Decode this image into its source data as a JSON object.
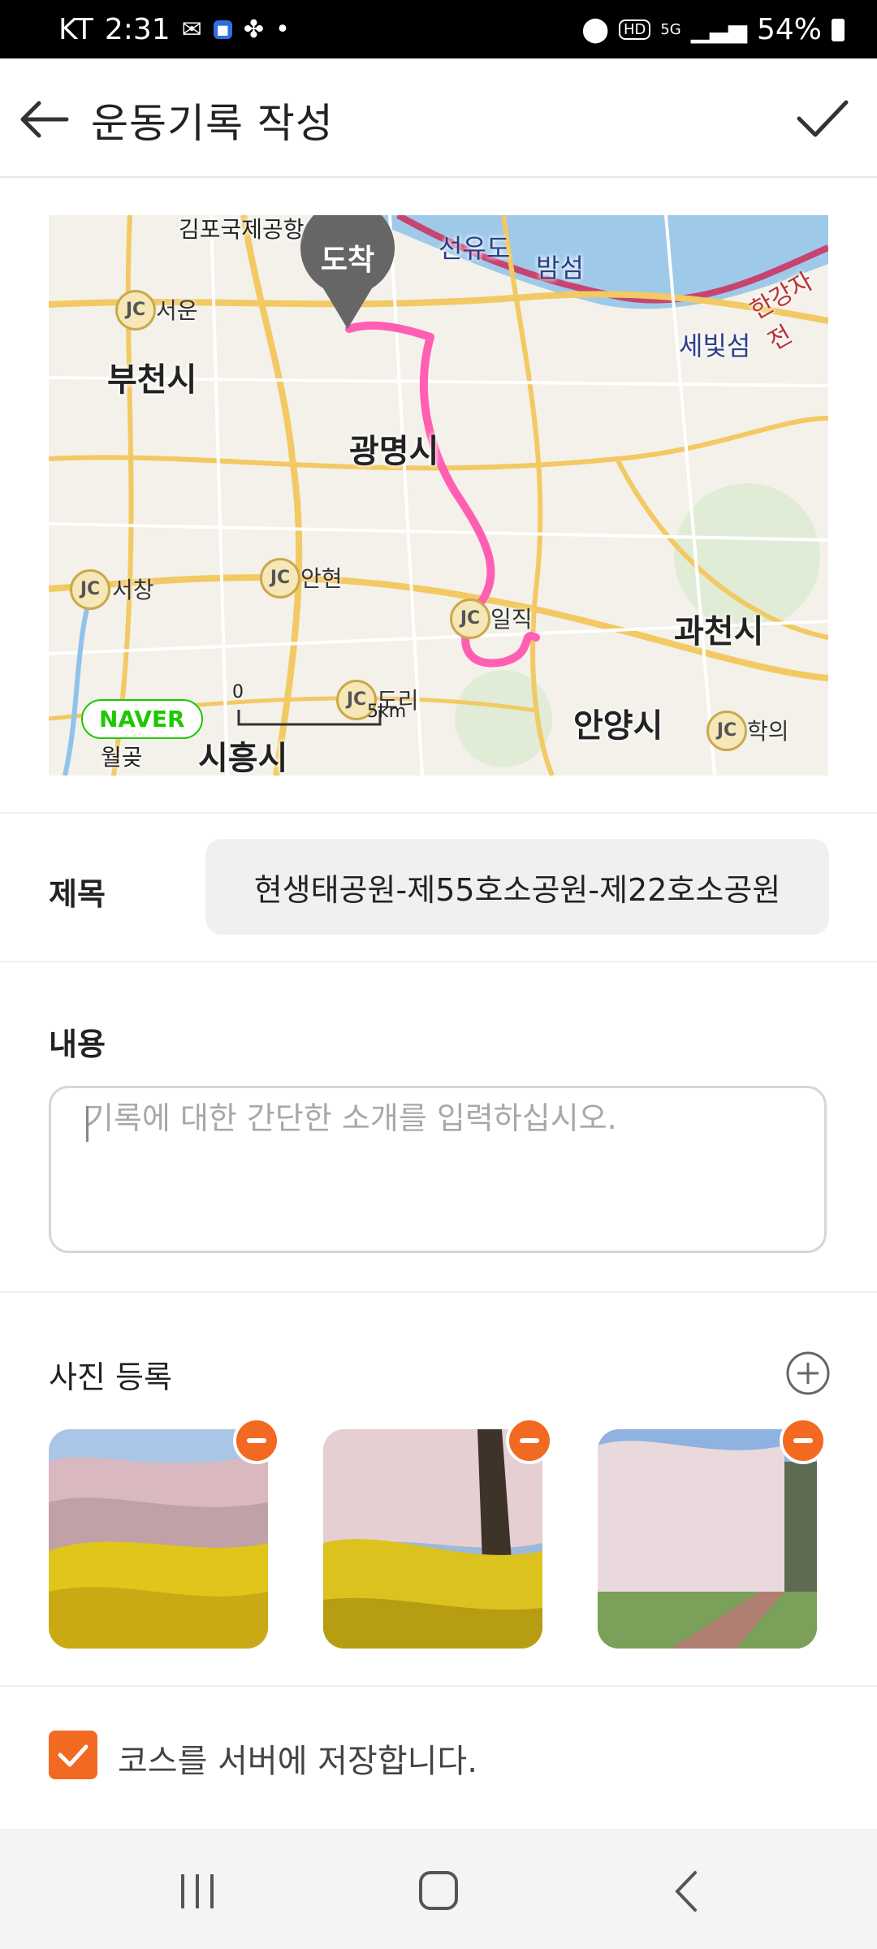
{
  "status_bar": {
    "carrier": "KT",
    "time": "2:31",
    "battery": "54%",
    "network": "5G",
    "hd": "HD"
  },
  "app_bar": {
    "title": "운동기록 작성"
  },
  "map": {
    "arrival_label": "도착",
    "brand": "NAVER",
    "scale_start": "0",
    "scale_end": "5km",
    "cities": [
      "부천시",
      "광명시",
      "과천시",
      "안양시",
      "시흥시"
    ],
    "places": [
      "선유도",
      "밤섬",
      "세빛섬",
      "한강자전",
      "월곶",
      "김포국제공항"
    ],
    "junctions": [
      "서운",
      "안현",
      "서창",
      "일직",
      "도리",
      "학의"
    ],
    "route_color": "#ff5fb3"
  },
  "form": {
    "title_label": "제목",
    "title_value": "현생태공원-제55호소공원-제22호소공원",
    "content_label": "내용",
    "content_placeholder": "기록에 대한 간단한 소개를 입력하십시오.",
    "photo_label": "사진 등록",
    "photos_count": 3,
    "save_course_label": "코스를 서버에 저장합니다.",
    "save_course_checked": true,
    "accent_color": "#f26a21"
  }
}
